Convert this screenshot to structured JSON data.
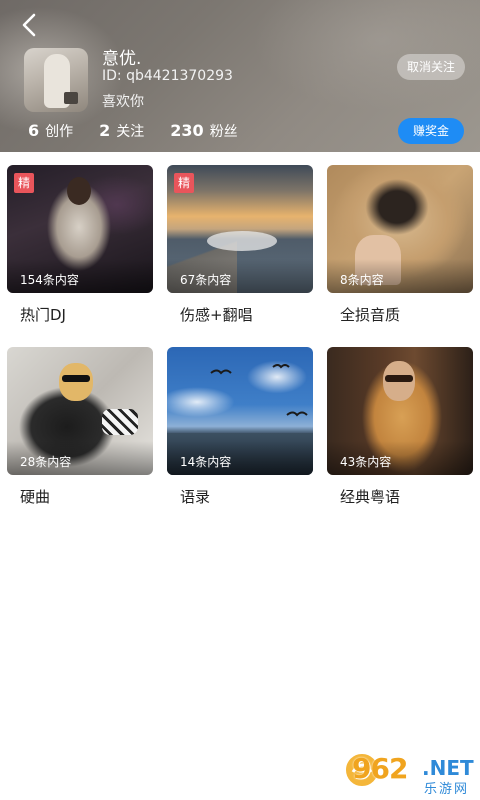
{
  "header": {
    "name": "意优.",
    "id": "ID: qb4421370293",
    "bio": "喜欢你",
    "unfollow_label": "取消关注",
    "reward_label": "赚奖金",
    "stats": [
      {
        "num": "6",
        "label": "创作"
      },
      {
        "num": "2",
        "label": "关注"
      },
      {
        "num": "230",
        "label": "粉丝"
      }
    ]
  },
  "cards": [
    {
      "title": "热门DJ",
      "count": "154条内容",
      "badge": "精"
    },
    {
      "title": "伤感+翻唱",
      "count": "67条内容",
      "badge": "精"
    },
    {
      "title": "全损音质",
      "count": "8条内容",
      "badge": ""
    },
    {
      "title": "硬曲",
      "count": "28条内容",
      "badge": ""
    },
    {
      "title": "语录",
      "count": "14条内容",
      "badge": ""
    },
    {
      "title": "经典粤语",
      "count": "43条内容",
      "badge": ""
    }
  ],
  "watermark": {
    "number": "962",
    "net": ".NET",
    "cn": "乐游网"
  },
  "colors": {
    "accent": "#1e8cf5",
    "badge": "#e9555b"
  }
}
